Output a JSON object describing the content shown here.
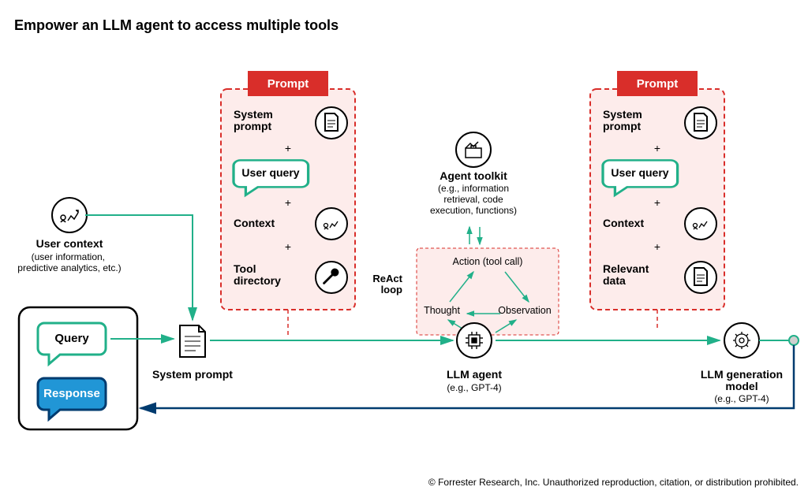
{
  "title": "Empower an LLM agent to access multiple tools",
  "userContext": {
    "label": "User context",
    "sub": "(user information,\npredictive analytics, etc.)"
  },
  "queryBubble": "Query",
  "responseBubble": "Response",
  "systemPromptLabel": "System prompt",
  "llmAgent": {
    "label": "LLM agent",
    "sub": "(e.g., GPT-4)"
  },
  "llmGen": {
    "label": "LLM generation\nmodel",
    "sub": "(e.g., GPT-4)"
  },
  "agentToolkit": {
    "label": "Agent toolkit",
    "sub": "(e.g., information\nretrieval, code\nexecution, functions)"
  },
  "reactLoop": {
    "label": "ReAct\nloop",
    "thought": "Thought",
    "action": "Action (tool call)",
    "observation": "Observation"
  },
  "prompt1": {
    "header": "Prompt",
    "items": [
      "System\nprompt",
      "User query",
      "Context",
      "Tool\ndirectory"
    ]
  },
  "prompt2": {
    "header": "Prompt",
    "items": [
      "System\nprompt",
      "User query",
      "Context",
      "Relevant\ndata"
    ]
  },
  "footer": "© Forrester Research, Inc. Unauthorized reproduction, citation, or distribution prohibited."
}
